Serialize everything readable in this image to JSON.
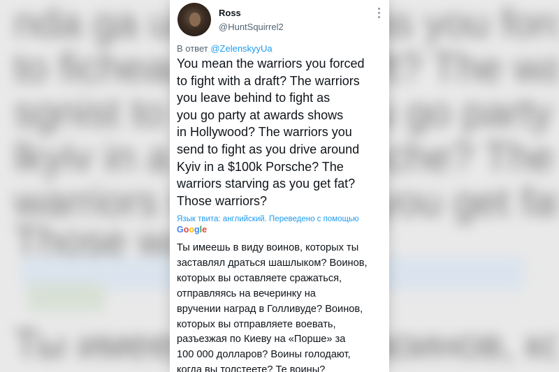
{
  "tweet": {
    "author_name": "Ross",
    "author_handle": "@HuntSquirrel2",
    "reply_prefix": "В ответ",
    "reply_mention": "@ZelenskyyUa",
    "text_lines": [
      "You mean the warriors you forced",
      "to fight with a draft? The warriors",
      "you leave behind to fight as",
      "you go party at awards shows",
      "in Hollywood? The warriors you",
      "send to fight as you drive around",
      "Kyiv in a $100k Porsche? The",
      "warriors starving as you get fat?",
      "Those warriors?"
    ],
    "translation_note": "Язык твита: английский. Переведено с помощью",
    "translation_provider": "Google",
    "translation_lines": [
      "Ты имеешь в виду воинов, которых ты",
      "заставлял драться шашлыком? Воинов,",
      "которых вы оставляете сражаться,",
      "отправляясь на вечеринку на",
      "вручении наград в Голливуде? Воинов,",
      "которых вы отправляете воевать,",
      "разъезжая по Киеву на «Порше» за",
      "100 000 долларов? Воины голодают,",
      "когда вы толстеете? Те воины?"
    ]
  },
  "icons": {
    "more": "more-vertical-icon"
  },
  "colors": {
    "link": "#1d9bf0",
    "text": "#0f1419",
    "secondary": "#536471",
    "background": "#e9e9e9"
  }
}
